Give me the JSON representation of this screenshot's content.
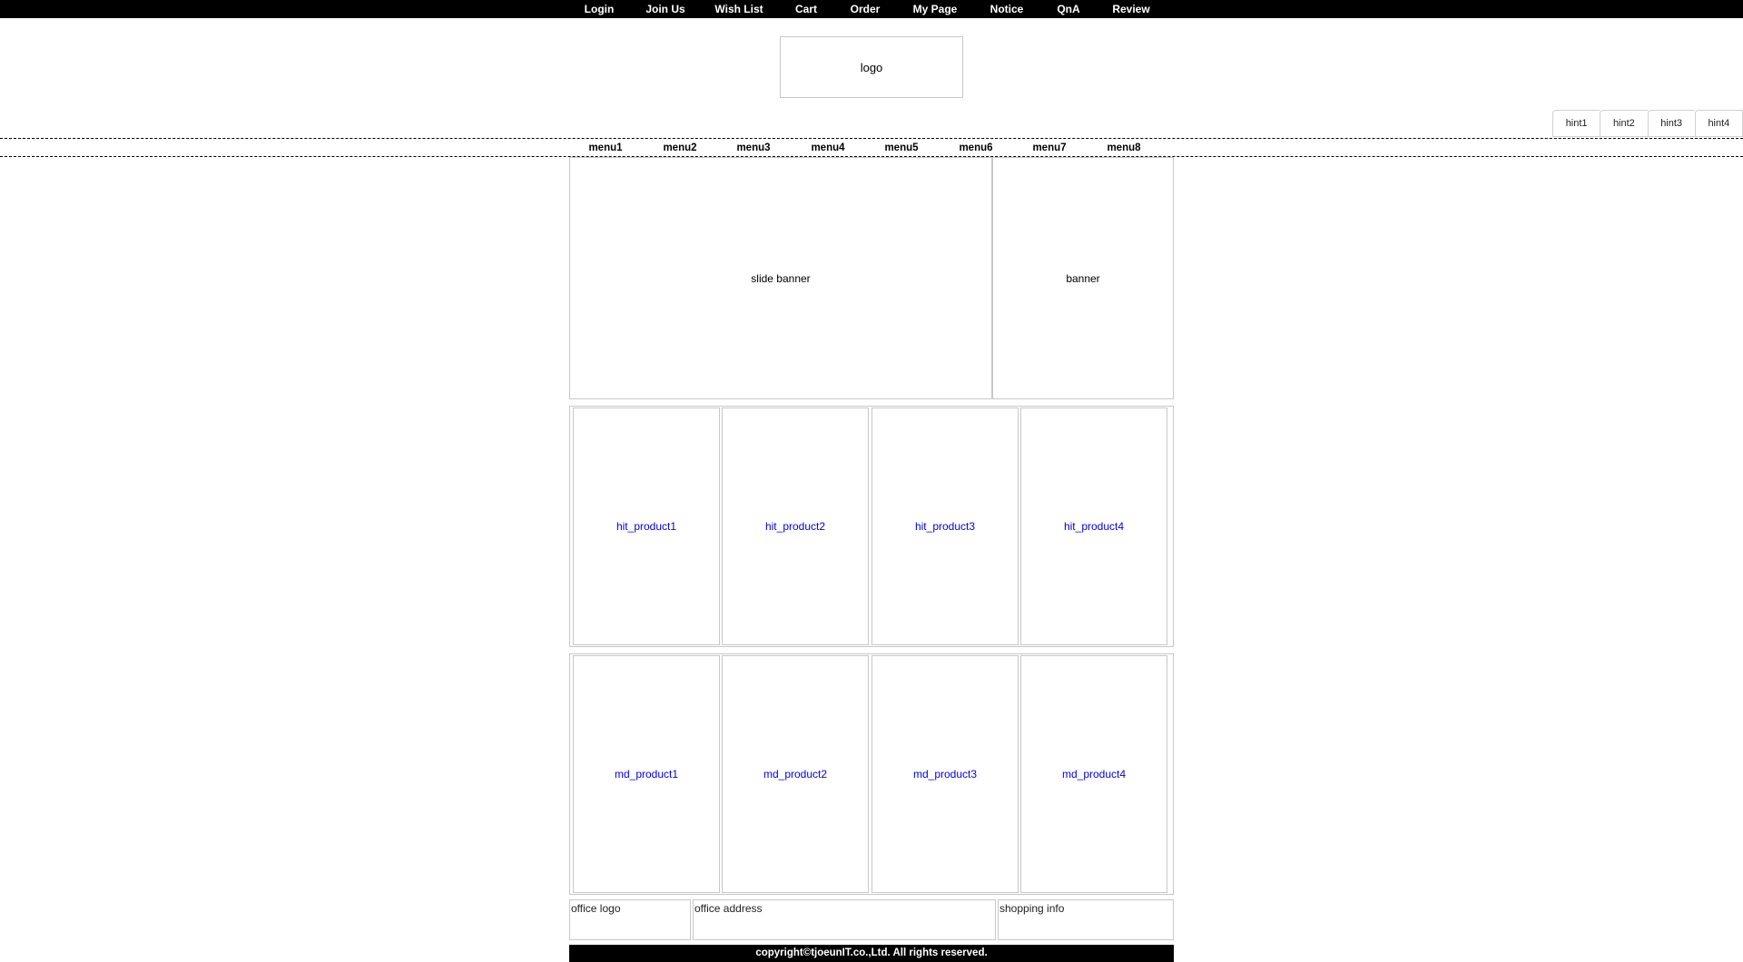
{
  "top_nav": [
    "Login",
    "Join Us",
    "Wish List",
    "Cart",
    "Order",
    "My Page",
    "Notice",
    "QnA",
    "Review"
  ],
  "logo": "logo",
  "hints": [
    "hint1",
    "hint2",
    "hint3",
    "hint4"
  ],
  "menu": [
    "menu1",
    "menu2",
    "menu3",
    "menu4",
    "menu5",
    "menu6",
    "menu7",
    "menu8"
  ],
  "banners": {
    "slide": "slide banner",
    "side": "banner"
  },
  "hit_products": [
    "hit_product1",
    "hit_product2",
    "hit_product3",
    "hit_product4"
  ],
  "md_products": [
    "md_product1",
    "md_product2",
    "md_product3",
    "md_product4"
  ],
  "footer": {
    "office_logo": "office logo",
    "office_address": "office address",
    "shopping_info": "shopping info",
    "copyright": "copyright©tjoeunIT.co.,Ltd. All rights reserved."
  },
  "colors": {
    "topbar_bg": "#000000",
    "product_link": "#0000ee",
    "border": "#c8c8c8"
  }
}
